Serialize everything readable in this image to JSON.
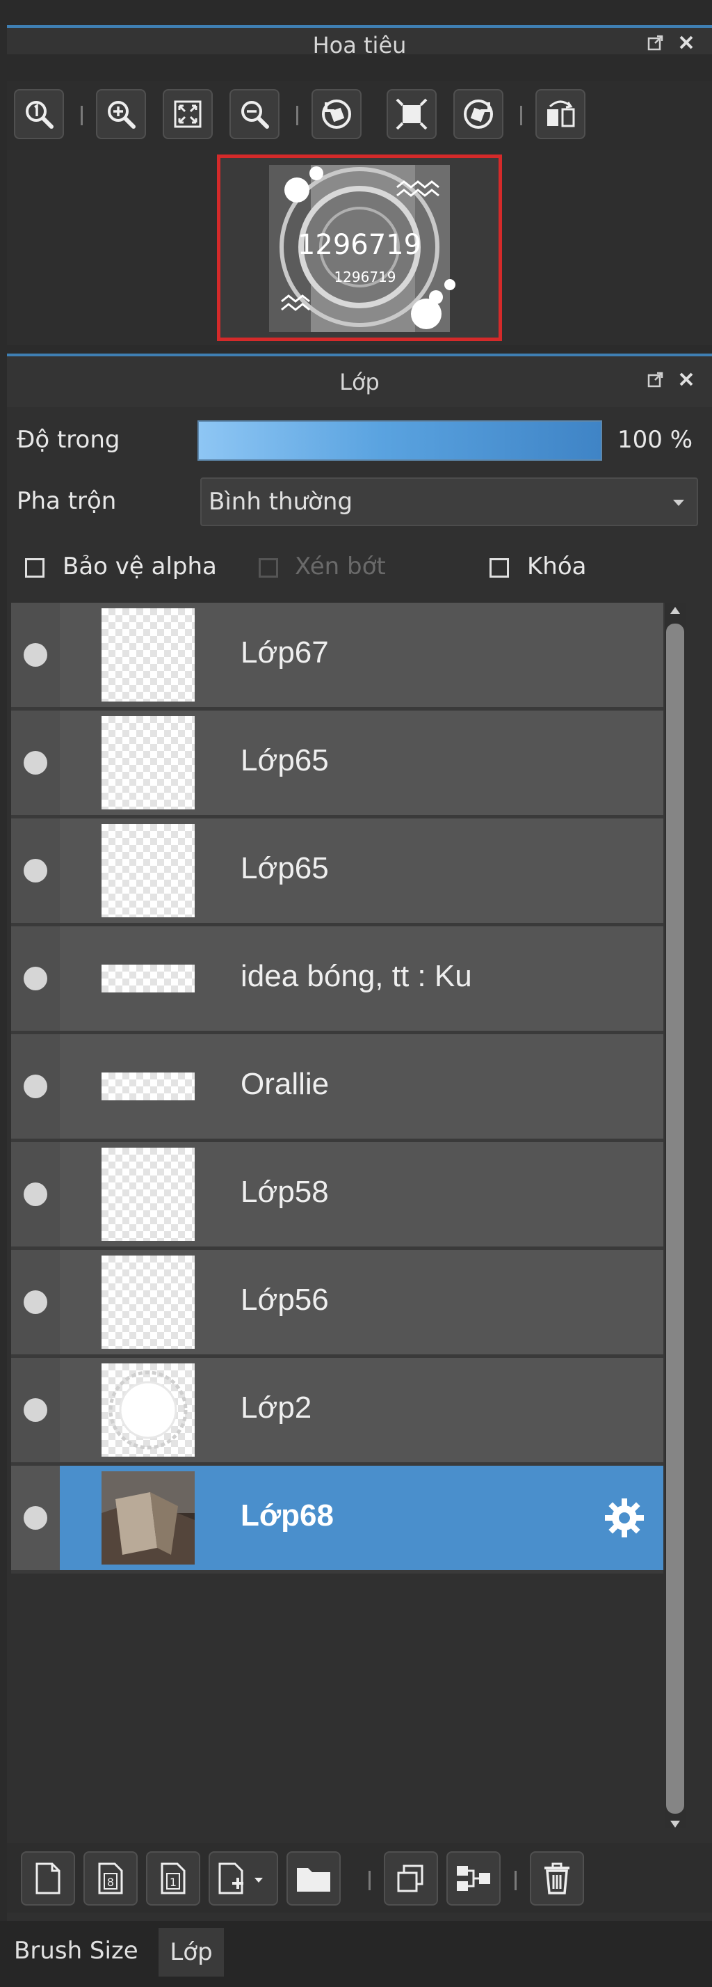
{
  "navigator": {
    "title": "Hoa tiêu",
    "toolbar_icons": [
      "zoom-actual-icon",
      "zoom-in-icon",
      "fit-screen-icon",
      "zoom-out-icon",
      "rotate-left-icon",
      "reset-view-icon",
      "rotate-right-icon",
      "flip-horizontal-icon"
    ],
    "preview": {
      "main_text": "1296719",
      "small_text": "1296719"
    }
  },
  "layers_panel": {
    "title": "Lớp",
    "opacity_label": "Độ trong",
    "opacity_value": "100 %",
    "opacity_level": 1.0,
    "blend_label": "Pha trộn",
    "blend_value": "Bình thường",
    "protect_alpha_label": "Bảo vệ alpha",
    "clipping_label": "Xén bớt",
    "lock_label": "Khóa",
    "layers": [
      {
        "name": "Lớp67",
        "thumb": "checker"
      },
      {
        "name": "Lớp65",
        "thumb": "checker"
      },
      {
        "name": "Lớp65",
        "thumb": "checker"
      },
      {
        "name": "idea bóng, tt : Ku",
        "thumb": "checker-wide"
      },
      {
        "name": "Orallie",
        "thumb": "checker-wide"
      },
      {
        "name": "Lớp58",
        "thumb": "checker"
      },
      {
        "name": "Lớp56",
        "thumb": "checker"
      },
      {
        "name": "Lớp2",
        "thumb": "circle"
      },
      {
        "name": "Lớp68",
        "thumb": "photo",
        "selected": true
      }
    ],
    "bottom_toolbar_icons": [
      "new-layer-icon",
      "new-layer-8bit-icon",
      "new-layer-1bit-icon",
      "add-layer-menu-icon",
      "new-folder-icon",
      "duplicate-layer-icon",
      "merge-layer-icon",
      "delete-layer-icon"
    ]
  },
  "tabs": [
    {
      "label": "Brush Size",
      "active": false
    },
    {
      "label": "Lớp",
      "active": true
    }
  ],
  "colors": {
    "accent": "#3f7fb3",
    "selection": "#4a8fcc",
    "navigator_frame": "#d42a2a"
  }
}
